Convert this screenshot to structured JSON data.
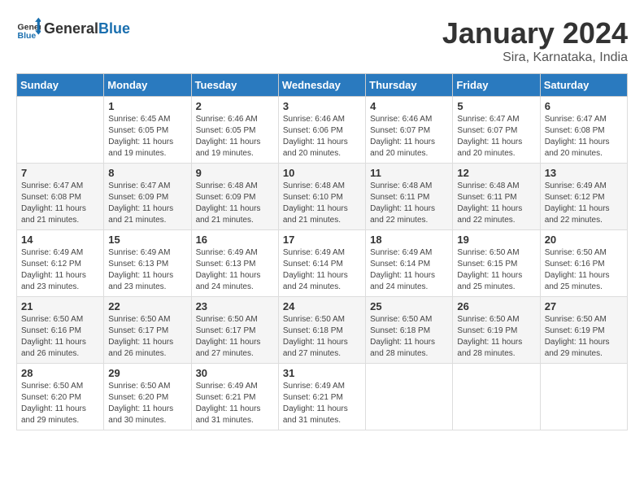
{
  "header": {
    "logo_general": "General",
    "logo_blue": "Blue",
    "title": "January 2024",
    "subtitle": "Sira, Karnataka, India"
  },
  "calendar": {
    "headers": [
      "Sunday",
      "Monday",
      "Tuesday",
      "Wednesday",
      "Thursday",
      "Friday",
      "Saturday"
    ],
    "weeks": [
      [
        {
          "day": "",
          "detail": ""
        },
        {
          "day": "1",
          "detail": "Sunrise: 6:45 AM\nSunset: 6:05 PM\nDaylight: 11 hours\nand 19 minutes."
        },
        {
          "day": "2",
          "detail": "Sunrise: 6:46 AM\nSunset: 6:05 PM\nDaylight: 11 hours\nand 19 minutes."
        },
        {
          "day": "3",
          "detail": "Sunrise: 6:46 AM\nSunset: 6:06 PM\nDaylight: 11 hours\nand 20 minutes."
        },
        {
          "day": "4",
          "detail": "Sunrise: 6:46 AM\nSunset: 6:07 PM\nDaylight: 11 hours\nand 20 minutes."
        },
        {
          "day": "5",
          "detail": "Sunrise: 6:47 AM\nSunset: 6:07 PM\nDaylight: 11 hours\nand 20 minutes."
        },
        {
          "day": "6",
          "detail": "Sunrise: 6:47 AM\nSunset: 6:08 PM\nDaylight: 11 hours\nand 20 minutes."
        }
      ],
      [
        {
          "day": "7",
          "detail": "Sunrise: 6:47 AM\nSunset: 6:08 PM\nDaylight: 11 hours\nand 21 minutes."
        },
        {
          "day": "8",
          "detail": "Sunrise: 6:47 AM\nSunset: 6:09 PM\nDaylight: 11 hours\nand 21 minutes."
        },
        {
          "day": "9",
          "detail": "Sunrise: 6:48 AM\nSunset: 6:09 PM\nDaylight: 11 hours\nand 21 minutes."
        },
        {
          "day": "10",
          "detail": "Sunrise: 6:48 AM\nSunset: 6:10 PM\nDaylight: 11 hours\nand 21 minutes."
        },
        {
          "day": "11",
          "detail": "Sunrise: 6:48 AM\nSunset: 6:11 PM\nDaylight: 11 hours\nand 22 minutes."
        },
        {
          "day": "12",
          "detail": "Sunrise: 6:48 AM\nSunset: 6:11 PM\nDaylight: 11 hours\nand 22 minutes."
        },
        {
          "day": "13",
          "detail": "Sunrise: 6:49 AM\nSunset: 6:12 PM\nDaylight: 11 hours\nand 22 minutes."
        }
      ],
      [
        {
          "day": "14",
          "detail": "Sunrise: 6:49 AM\nSunset: 6:12 PM\nDaylight: 11 hours\nand 23 minutes."
        },
        {
          "day": "15",
          "detail": "Sunrise: 6:49 AM\nSunset: 6:13 PM\nDaylight: 11 hours\nand 23 minutes."
        },
        {
          "day": "16",
          "detail": "Sunrise: 6:49 AM\nSunset: 6:13 PM\nDaylight: 11 hours\nand 24 minutes."
        },
        {
          "day": "17",
          "detail": "Sunrise: 6:49 AM\nSunset: 6:14 PM\nDaylight: 11 hours\nand 24 minutes."
        },
        {
          "day": "18",
          "detail": "Sunrise: 6:49 AM\nSunset: 6:14 PM\nDaylight: 11 hours\nand 24 minutes."
        },
        {
          "day": "19",
          "detail": "Sunrise: 6:50 AM\nSunset: 6:15 PM\nDaylight: 11 hours\nand 25 minutes."
        },
        {
          "day": "20",
          "detail": "Sunrise: 6:50 AM\nSunset: 6:16 PM\nDaylight: 11 hours\nand 25 minutes."
        }
      ],
      [
        {
          "day": "21",
          "detail": "Sunrise: 6:50 AM\nSunset: 6:16 PM\nDaylight: 11 hours\nand 26 minutes."
        },
        {
          "day": "22",
          "detail": "Sunrise: 6:50 AM\nSunset: 6:17 PM\nDaylight: 11 hours\nand 26 minutes."
        },
        {
          "day": "23",
          "detail": "Sunrise: 6:50 AM\nSunset: 6:17 PM\nDaylight: 11 hours\nand 27 minutes."
        },
        {
          "day": "24",
          "detail": "Sunrise: 6:50 AM\nSunset: 6:18 PM\nDaylight: 11 hours\nand 27 minutes."
        },
        {
          "day": "25",
          "detail": "Sunrise: 6:50 AM\nSunset: 6:18 PM\nDaylight: 11 hours\nand 28 minutes."
        },
        {
          "day": "26",
          "detail": "Sunrise: 6:50 AM\nSunset: 6:19 PM\nDaylight: 11 hours\nand 28 minutes."
        },
        {
          "day": "27",
          "detail": "Sunrise: 6:50 AM\nSunset: 6:19 PM\nDaylight: 11 hours\nand 29 minutes."
        }
      ],
      [
        {
          "day": "28",
          "detail": "Sunrise: 6:50 AM\nSunset: 6:20 PM\nDaylight: 11 hours\nand 29 minutes."
        },
        {
          "day": "29",
          "detail": "Sunrise: 6:50 AM\nSunset: 6:20 PM\nDaylight: 11 hours\nand 30 minutes."
        },
        {
          "day": "30",
          "detail": "Sunrise: 6:49 AM\nSunset: 6:21 PM\nDaylight: 11 hours\nand 31 minutes."
        },
        {
          "day": "31",
          "detail": "Sunrise: 6:49 AM\nSunset: 6:21 PM\nDaylight: 11 hours\nand 31 minutes."
        },
        {
          "day": "",
          "detail": ""
        },
        {
          "day": "",
          "detail": ""
        },
        {
          "day": "",
          "detail": ""
        }
      ]
    ]
  }
}
